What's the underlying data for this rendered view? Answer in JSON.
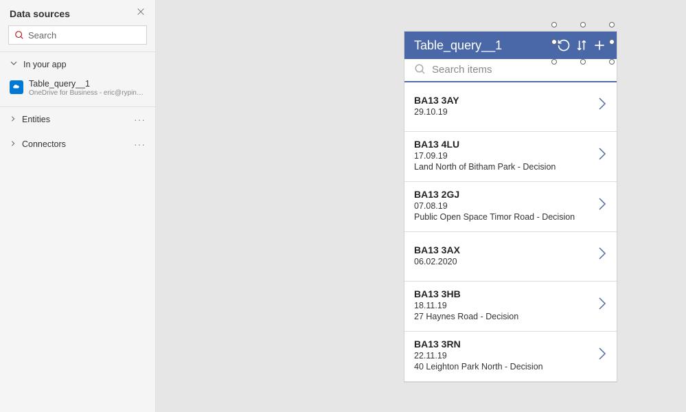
{
  "panel": {
    "title": "Data sources",
    "search_placeholder": "Search",
    "section_in_app": "In your app",
    "item": {
      "name": "Table_query__1",
      "sub": "OneDrive for Business - eric@rypinslaw.com"
    },
    "cat_entities": "Entities",
    "cat_connectors": "Connectors"
  },
  "phone": {
    "title": "Table_query__1",
    "search_placeholder": "Search items",
    "items": [
      {
        "title": "BA13 3AY",
        "date": "29.10.19",
        "desc": ""
      },
      {
        "title": "BA13 4LU",
        "date": "17.09.19",
        "desc": "Land North of Bitham Park - Decision"
      },
      {
        "title": "BA13 2GJ",
        "date": "07.08.19",
        "desc": "Public Open Space Timor Road - Decision"
      },
      {
        "title": "BA13 3AX",
        "date": "06.02.2020",
        "desc": ""
      },
      {
        "title": "BA13 3HB",
        "date": "18.11.19",
        "desc": "27 Haynes Road - Decision"
      },
      {
        "title": "BA13 3RN",
        "date": "22.11.19",
        "desc": "40 Leighton Park North - Decision"
      }
    ]
  }
}
